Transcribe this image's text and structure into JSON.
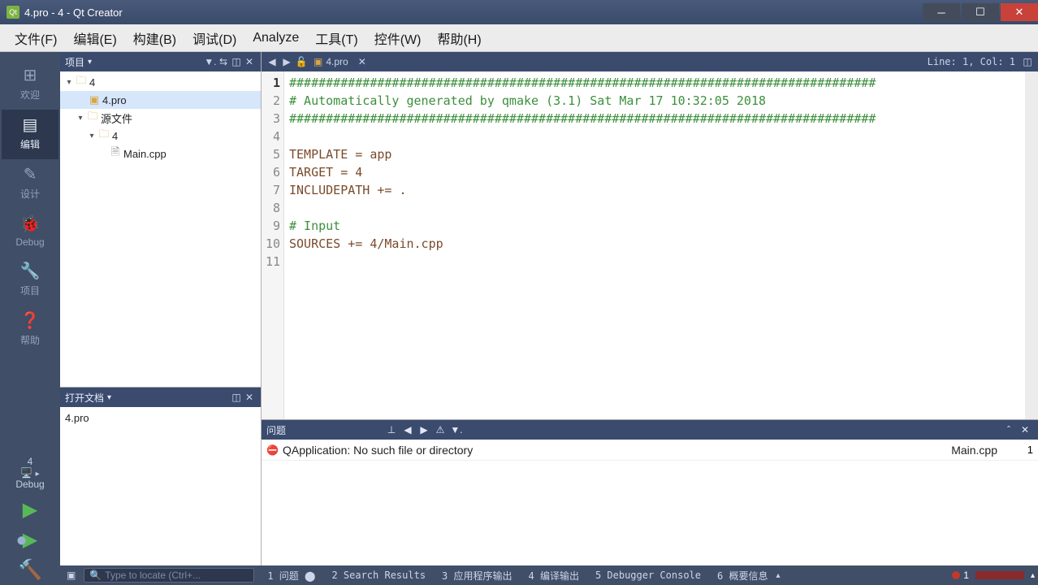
{
  "window": {
    "title": "4.pro - 4 - Qt Creator"
  },
  "menu": [
    "文件(F)",
    "编辑(E)",
    "构建(B)",
    "调试(D)",
    "Analyze",
    "工具(T)",
    "控件(W)",
    "帮助(H)"
  ],
  "modes": {
    "welcome": "欢迎",
    "edit": "编辑",
    "design": "设计",
    "debug": "Debug",
    "project": "项目",
    "help": "帮助"
  },
  "kit": {
    "name": "4",
    "config": "Debug"
  },
  "project_panel": {
    "title": "项目"
  },
  "tree": {
    "root": "4",
    "pro": "4.pro",
    "sources_label": "源文件",
    "subfolder": "4",
    "main": "Main.cpp"
  },
  "opendocs": {
    "title": "打开文档",
    "items": [
      "4.pro"
    ]
  },
  "editor": {
    "filename": "4.pro",
    "cursor": "Line: 1, Col: 1",
    "lines": [
      "################################################################################",
      "# Automatically generated by qmake (3.1) Sat Mar 17 10:32:05 2018",
      "################################################################################",
      "",
      "TEMPLATE = app",
      "TARGET = 4",
      "INCLUDEPATH += .",
      "",
      "# Input",
      "SOURCES += 4/Main.cpp",
      ""
    ]
  },
  "issues": {
    "title": "问题",
    "row": {
      "msg": "QApplication: No such file or directory",
      "file": "Main.cpp",
      "line": "1"
    }
  },
  "status": {
    "locate_placeholder": "Type to locate (Ctrl+...",
    "panes": [
      "1 问题 ⬤",
      "2 Search Results",
      "3 应用程序输出",
      "4 编译输出",
      "5 Debugger Console",
      "6 概要信息"
    ],
    "err_count": "1"
  }
}
